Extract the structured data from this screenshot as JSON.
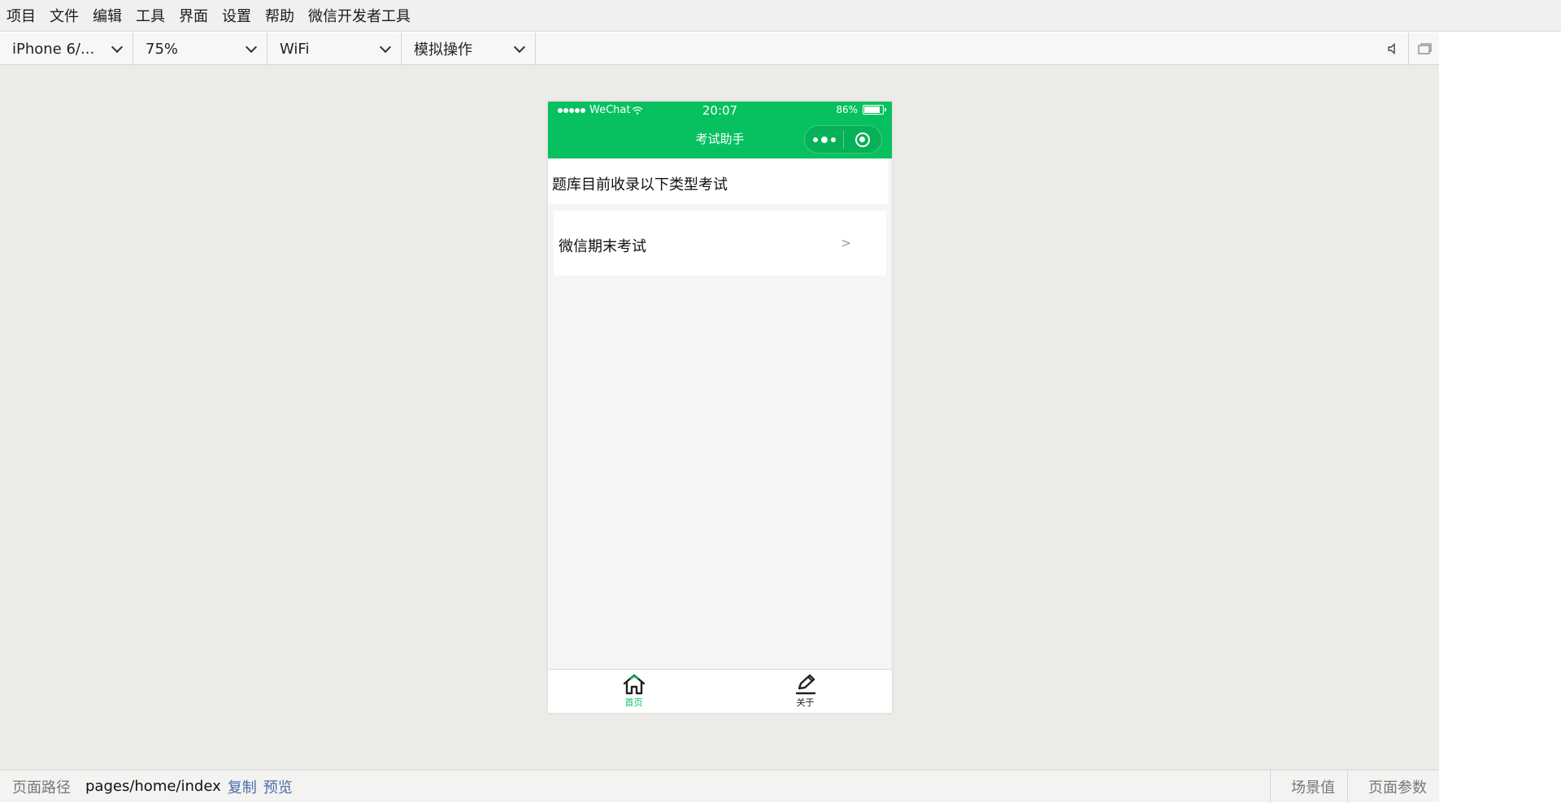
{
  "menubar": {
    "items": [
      "项目",
      "文件",
      "编辑",
      "工具",
      "界面",
      "设置",
      "帮助",
      "微信开发者工具"
    ]
  },
  "toolbar": {
    "device": "iPhone 6/...",
    "zoom": "75%",
    "network": "WiFi",
    "operation": "模拟操作"
  },
  "phone": {
    "status": {
      "carrier": "WeChat",
      "time": "20:07",
      "battery": "86%"
    },
    "nav_title": "考试助手",
    "content_header": "题库目前收录以下类型考试",
    "exam_items": [
      {
        "name": "微信期末考试",
        "arrow": ">"
      }
    ],
    "tabs": [
      {
        "label": "首页",
        "icon": "home-icon",
        "active": true
      },
      {
        "label": "关于",
        "icon": "edit-icon",
        "active": false
      }
    ],
    "colors": {
      "brand_green": "#07c160"
    }
  },
  "bottombar": {
    "path_label": "页面路径",
    "path": "pages/home/index",
    "copy": "复制",
    "preview": "预览",
    "scene": "场景值",
    "params": "页面参数"
  }
}
